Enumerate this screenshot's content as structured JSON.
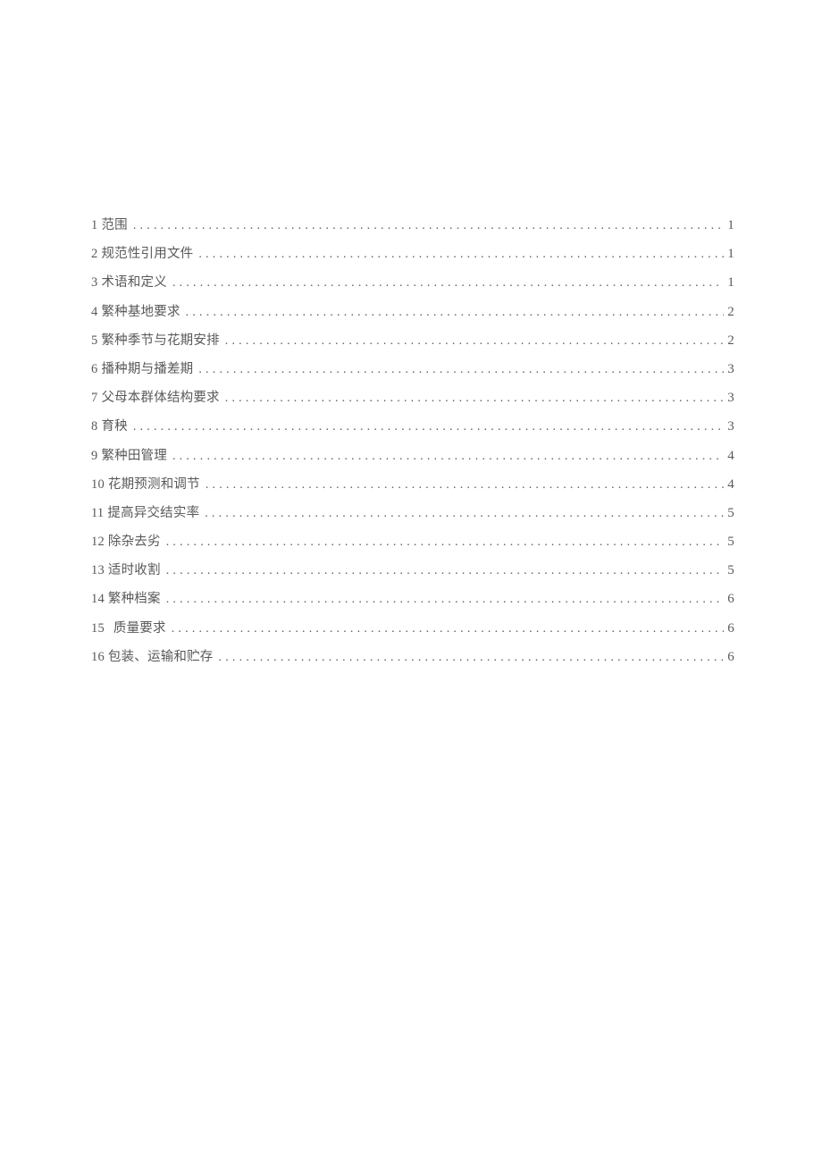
{
  "toc": {
    "entries": [
      {
        "num": "1",
        "title": "范围",
        "page": "1",
        "gap": false
      },
      {
        "num": "2",
        "title": "规范性引用文件",
        "page": "1",
        "gap": false
      },
      {
        "num": "3",
        "title": "术语和定义",
        "page": "1",
        "gap": false
      },
      {
        "num": "4",
        "title": "繁种基地要求",
        "page": "2",
        "gap": false
      },
      {
        "num": "5",
        "title": "繁种季节与花期安排",
        "page": "2",
        "gap": false
      },
      {
        "num": "6",
        "title": "播种期与播差期",
        "page": "3",
        "gap": false
      },
      {
        "num": "7",
        "title": "父母本群体结构要求",
        "page": "3",
        "gap": false
      },
      {
        "num": "8",
        "title": "育秧",
        "page": "3",
        "gap": false
      },
      {
        "num": "9",
        "title": "繁种田管理",
        "page": "4",
        "gap": false
      },
      {
        "num": "10",
        "title": "花期预测和调节",
        "page": "4",
        "gap": false
      },
      {
        "num": "11",
        "title": "提高异交结实率",
        "page": "5",
        "gap": false
      },
      {
        "num": "12",
        "title": "除杂去劣",
        "page": "5",
        "gap": false
      },
      {
        "num": "13",
        "title": "适时收割",
        "page": "5",
        "gap": false
      },
      {
        "num": "14",
        "title": "繁种档案",
        "page": "6",
        "gap": false
      },
      {
        "num": "15",
        "title": "质量要求",
        "page": "6",
        "gap": true
      },
      {
        "num": "16",
        "title": "包装、运输和贮存",
        "page": "6",
        "gap": false
      }
    ]
  }
}
